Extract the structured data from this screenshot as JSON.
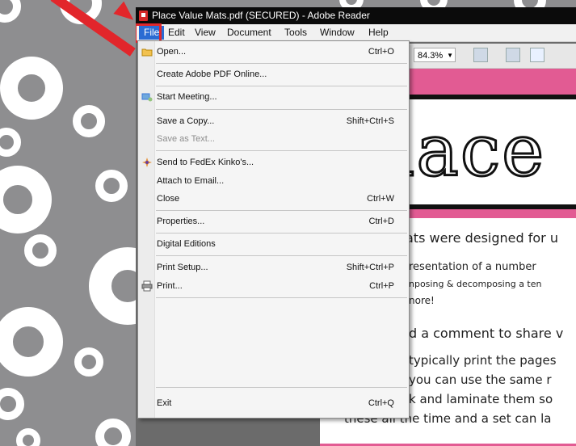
{
  "window": {
    "title": "Place Value Mats.pdf (SECURED) - Adobe Reader"
  },
  "menubar": {
    "items": [
      "File",
      "Edit",
      "View",
      "Document",
      "Tools",
      "Window",
      "Help"
    ]
  },
  "toolbar": {
    "zoom": "84.3%"
  },
  "file_menu": {
    "items": [
      {
        "label": "Open...",
        "shortcut": "Ctrl+O",
        "icon": "folder-icon"
      },
      {
        "label": "Create Adobe PDF Online...",
        "shortcut": ""
      },
      {
        "label": "Start Meeting...",
        "shortcut": "",
        "icon": "meeting-icon"
      },
      {
        "label": "Save a Copy...",
        "shortcut": "Shift+Ctrl+S"
      },
      {
        "label": "Save as Text...",
        "shortcut": "",
        "disabled": true
      },
      {
        "label": "Send to FedEx Kinko's...",
        "shortcut": "",
        "icon": "fedex-icon"
      },
      {
        "label": "Attach to Email...",
        "shortcut": ""
      },
      {
        "label": "Close",
        "shortcut": "Ctrl+W"
      },
      {
        "label": "Properties...",
        "shortcut": "Ctrl+D"
      },
      {
        "label": "Digital Editions",
        "shortcut": ""
      },
      {
        "label": "Print Setup...",
        "shortcut": "Shift+Ctrl+P"
      },
      {
        "label": "Print...",
        "shortcut": "Ctrl+P",
        "icon": "printer-icon"
      },
      {
        "label": "Exit",
        "shortcut": "Ctrl+Q"
      }
    ]
  },
  "document": {
    "heading": "Place",
    "lines": [
      "ats were designed for u",
      "resentation of a number",
      "nposing & decomposing a ten",
      "nore!",
      "d a comment to share v",
      "typically print the pages",
      "you can use the same r",
      "k and laminate them so",
      "these all the time and a set can la"
    ]
  },
  "colors": {
    "accent": "#e0272b",
    "menu_highlight": "#2a6bd3",
    "pink": "#e25b93"
  }
}
